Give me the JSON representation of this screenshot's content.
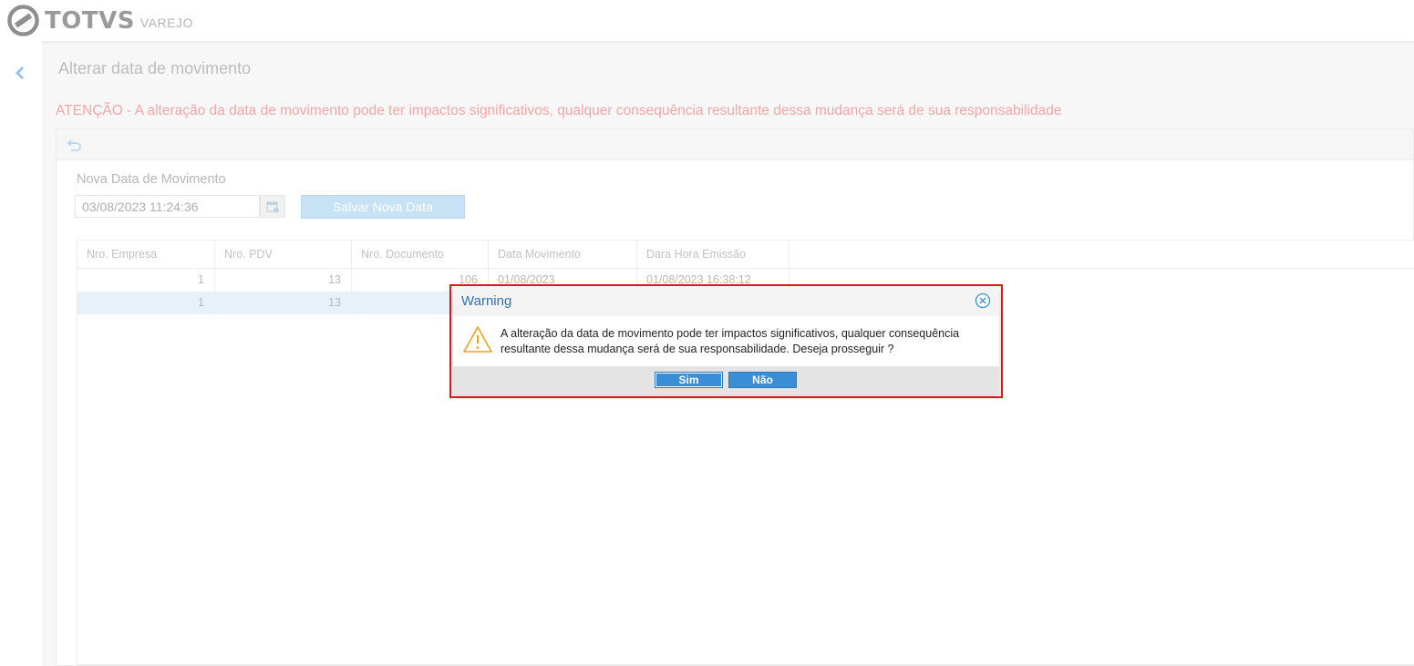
{
  "app": {
    "brand": "TOTVS",
    "brand_sub": "VAREJO"
  },
  "page": {
    "title": "Alterar data de movimento",
    "warning": "ATENÇÃO - A alteração da data de movimento pode ter impactos significativos, qualquer consequência resultante dessa mudança será de sua responsabilidade"
  },
  "form": {
    "date_label": "Nova Data de Movimento",
    "date_value": "03/08/2023 11:24:36",
    "save_label": "Salvar Nova Data"
  },
  "grid": {
    "columns": [
      "Nro. Empresa",
      "Nro. PDV",
      "Nro. Documento",
      "Data Movimento",
      "Dara Hora Emissão"
    ],
    "rows": [
      {
        "empresa": "1",
        "pdv": "13",
        "documento": "106",
        "data_movimento": "01/08/2023",
        "emissao": "01/08/2023 16:38:12"
      },
      {
        "empresa": "1",
        "pdv": "13",
        "documento": "",
        "data_movimento": "",
        "emissao": ""
      }
    ]
  },
  "dialog": {
    "title": "Warning",
    "message": "A alteração da data de movimento pode ter impactos significativos, qualquer consequência resultante dessa mudança será de sua responsabilidade. Deseja prosseguir ?",
    "yes_label": "Sim",
    "no_label": "Não"
  },
  "colors": {
    "accent": "#3a8ed6",
    "highlight_frame": "#e01a1a",
    "warning_text": "#f4a5a5"
  },
  "icons": {
    "logo": "totvs-logo-icon",
    "back": "chevron-left-icon",
    "undo": "undo-icon",
    "calendar": "calendar-icon",
    "close": "close-circle-icon",
    "warning": "warning-triangle-icon"
  }
}
